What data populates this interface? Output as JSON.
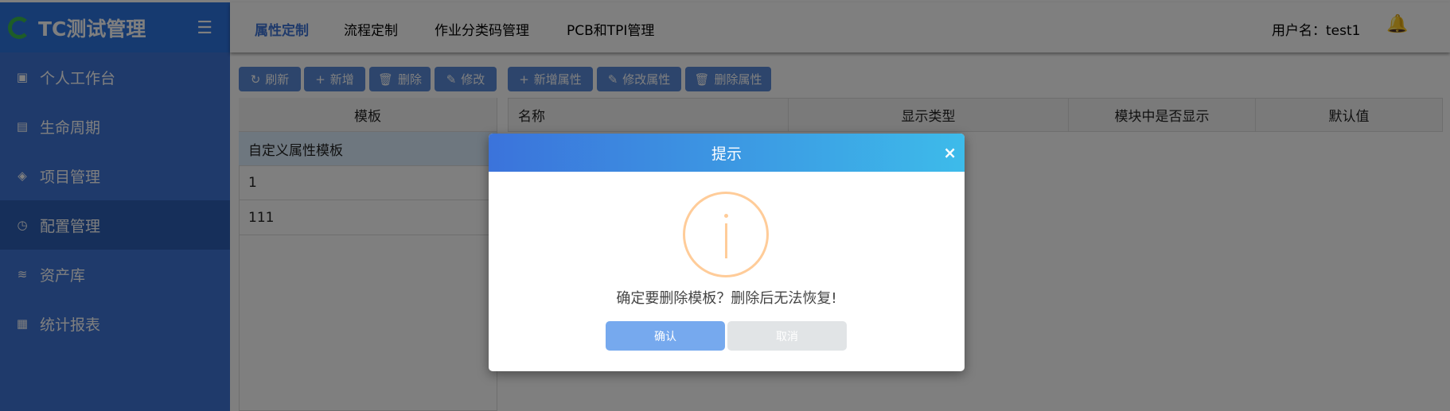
{
  "app": {
    "title": "TC测试管理"
  },
  "sidebar": {
    "items": [
      {
        "label": "个人工作台",
        "icon": "desktop-icon"
      },
      {
        "label": "生命周期",
        "icon": "book-icon"
      },
      {
        "label": "项目管理",
        "icon": "layers-icon"
      },
      {
        "label": "配置管理",
        "icon": "clock-icon",
        "active": true
      },
      {
        "label": "资产库",
        "icon": "database-icon"
      },
      {
        "label": "统计报表",
        "icon": "report-icon"
      }
    ]
  },
  "topnav": {
    "tabs": [
      "属性定制",
      "流程定制",
      "作业分类码管理",
      "PCB和TPI管理"
    ],
    "user": "用户名：test1"
  },
  "toolbar": {
    "refresh": "刷新",
    "add": "新增",
    "delete": "删除",
    "edit": "修改",
    "add_attr": "新增属性",
    "edit_attr": "修改属性",
    "delete_attr": "删除属性"
  },
  "template_table": {
    "header": "模板",
    "rows": [
      "自定义属性模板",
      "1",
      "111"
    ]
  },
  "attr_table": {
    "headers": [
      "名称",
      "显示类型",
      "模块中是否显示",
      "默认值"
    ]
  },
  "dialog": {
    "title": "提示",
    "close": "×",
    "message": "确定要删除模板？删除后无法恢复!",
    "confirm": "确认",
    "cancel": "取消"
  }
}
